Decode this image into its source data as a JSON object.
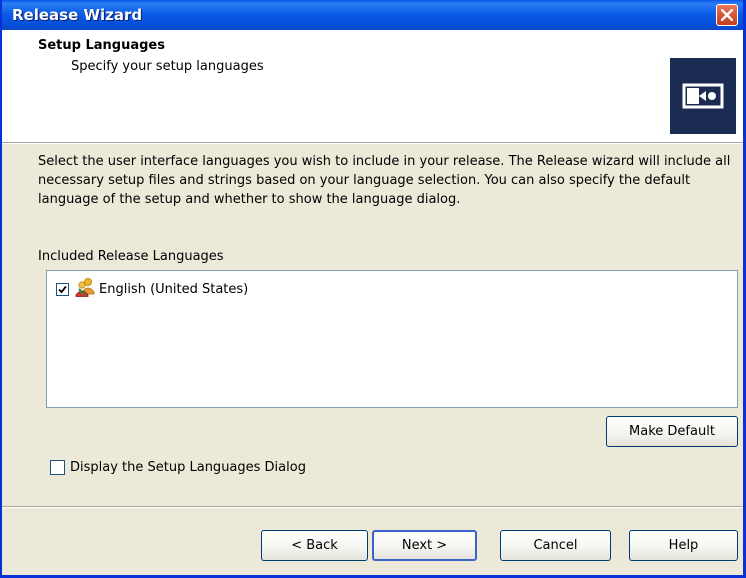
{
  "window": {
    "title": "Release Wizard"
  },
  "header": {
    "title": "Setup Languages",
    "subtitle": "Specify your setup languages"
  },
  "description": "Select the user interface languages you wish to include in your release. The Release wizard will include all necessary setup files and strings based on your language selection. You can also specify the default language of the setup and whether to show the language dialog.",
  "languages": {
    "label": "Included Release Languages",
    "items": [
      {
        "label": "English (United States)",
        "checked": true,
        "icon": "language-people-icon"
      }
    ]
  },
  "make_default_label": "Make Default",
  "display_dialog": {
    "label": "Display the Setup Languages Dialog",
    "checked": false
  },
  "footer": {
    "back_label": "< Back",
    "next_label": "Next >",
    "cancel_label": "Cancel",
    "help_label": "Help"
  },
  "colors": {
    "titlebar": "#0b5ce7",
    "close": "#d95434",
    "logo": "#1b2c52",
    "dialog_bg": "#ece9d8"
  }
}
